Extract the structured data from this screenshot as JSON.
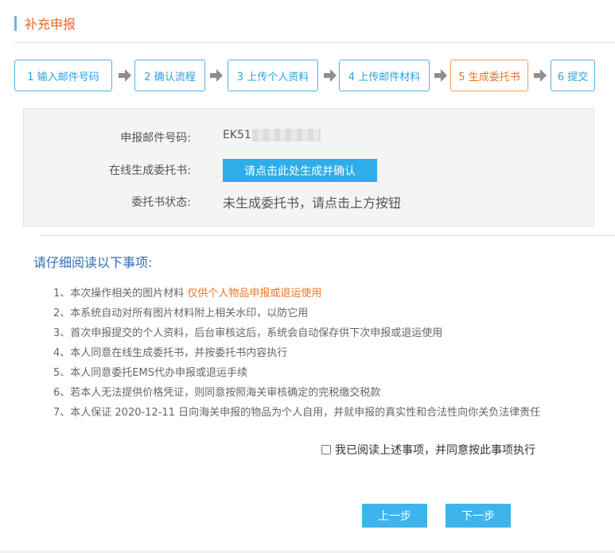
{
  "page": {
    "title": "补充申报"
  },
  "steps": [
    {
      "label": "1 输入邮件号码",
      "active": false
    },
    {
      "label": "2 确认流程",
      "active": false
    },
    {
      "label": "3 上传个人资料",
      "active": false
    },
    {
      "label": "4 上传邮件材料",
      "active": false
    },
    {
      "label": "5 生成委托书",
      "active": true
    },
    {
      "label": "6 提交",
      "active": false
    }
  ],
  "form": {
    "mail_label": "申报邮件号码:",
    "mail_value": "EK51",
    "online_label": "在线生成委托书:",
    "generate_button": "请点击此处生成并确认",
    "status_label": "委托书状态:",
    "status_value": "未生成委托书，请点击上方按钮"
  },
  "notice": {
    "title": "请仔细阅读以下事项:",
    "items": [
      {
        "text": "1、本次操作相关的图片材料 ",
        "highlight": "仅供个人物品申报或退运使用"
      },
      {
        "text": "2、本系统自动对所有图片材料附上相关水印，以防它用"
      },
      {
        "text": "3、首次申报提交的个人资料，后台审核这后，系统会自动保存供下次申报或退运使用"
      },
      {
        "text": "4、本人同意在线生成委托书，并按委托书内容执行"
      },
      {
        "text": "5、本人同意委托EMS代办申报或退运手续"
      },
      {
        "text": "6、若本人无法提供价格凭证，则同意按照海关审核确定的完税缴交税款"
      },
      {
        "text": "7、本人保证 2020-12-11 日向海关申报的物品为个人自用，并就申报的真实性和合法性向你关负法律责任"
      }
    ]
  },
  "agree": {
    "label": "我已阅读上述事项，并同意按此事项执行",
    "checked": false
  },
  "nav": {
    "prev": "上一步",
    "next": "下一步"
  },
  "colors": {
    "accent": "#2eaee9",
    "active_step": "#f0731f",
    "title": "#e6692b",
    "notice_title": "#2d6fb3"
  }
}
